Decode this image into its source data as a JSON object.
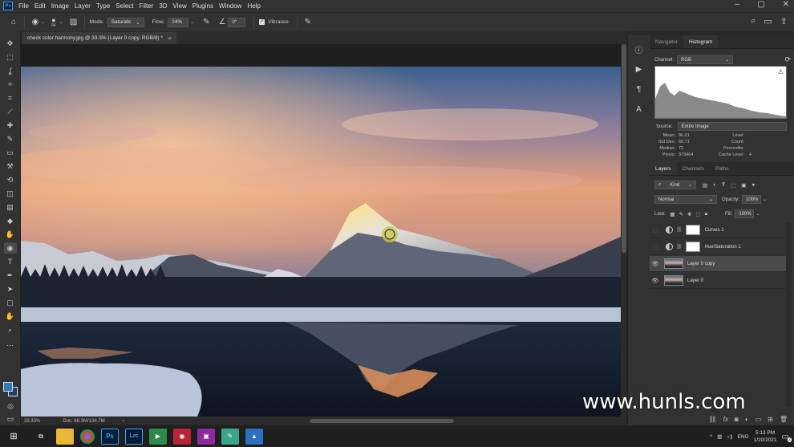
{
  "menubar": {
    "items": [
      "File",
      "Edit",
      "Image",
      "Layer",
      "Type",
      "Select",
      "Filter",
      "3D",
      "View",
      "Plugins",
      "Window",
      "Help"
    ]
  },
  "options": {
    "brush_size": "94",
    "mode_label": "Mode:",
    "mode_value": "Saturate",
    "flow_label": "Flow:",
    "flow_value": "24%",
    "angle_value": "0°",
    "vibrance_label": "Vibrance"
  },
  "document": {
    "tab_title": "check color harmony.jpg @ 33.3% (Layer 0 copy, RGB/8) *",
    "zoom": "33.33%",
    "doc_size": "Doc: 66.3M/136.7M"
  },
  "histogram_panel": {
    "tabs": [
      "Navigator",
      "Histogram"
    ],
    "channel_label": "Channel:",
    "channel_value": "RGB",
    "source_label": "Source:",
    "source_value": "Entire Image",
    "stats_left_labels": [
      "Mean:",
      "Std Dev:",
      "Median:",
      "Pixels:"
    ],
    "stats_left_values": [
      "86.01",
      "60.71",
      "72",
      "373464"
    ],
    "stats_right_labels": [
      "Level:",
      "Count:",
      "Percentile:",
      "Cache Level:"
    ],
    "cache_level": "4"
  },
  "layers_panel": {
    "tabs": [
      "Layers",
      "Channels",
      "Paths"
    ],
    "filter_kind": "Kind",
    "blend_mode": "Normal",
    "opacity_label": "Opacity:",
    "opacity_value": "100%",
    "lock_label": "Lock:",
    "fill_label": "Fill:",
    "fill_value": "100%",
    "layers": [
      {
        "name": "Curves 1"
      },
      {
        "name": "Hue/Saturation 1"
      },
      {
        "name": "Layer 0 copy"
      },
      {
        "name": "Layer 0"
      }
    ]
  },
  "taskbar": {
    "time": "5:13 PM",
    "date": "1/20/2021",
    "lang": "ENG",
    "notifications": "2"
  },
  "watermark": "www.hunls.com",
  "colors": {
    "accent": "#31a8ff",
    "foreground_swatch": "#2d7bb7",
    "background_swatch": "#1c3f6b"
  }
}
